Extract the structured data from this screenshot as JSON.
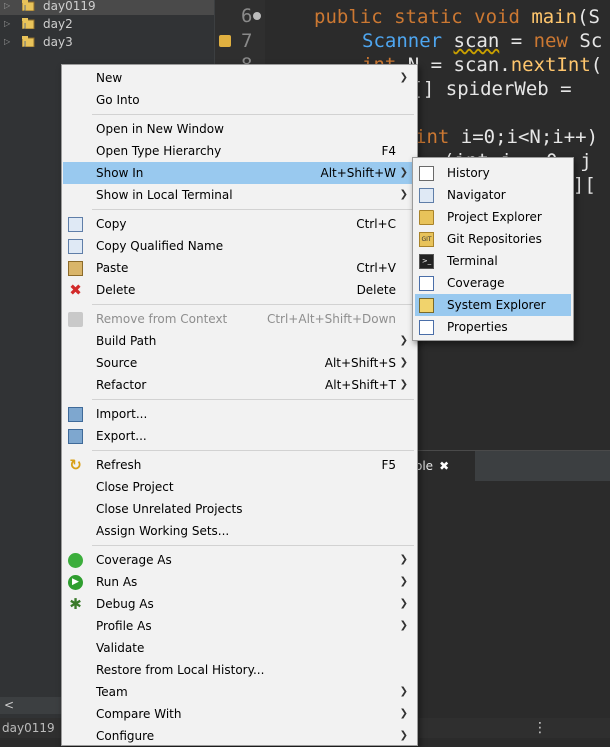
{
  "explorer": {
    "items": [
      {
        "label": "day0119",
        "selected": true
      },
      {
        "label": "day2",
        "selected": false
      },
      {
        "label": "day3",
        "selected": false
      }
    ],
    "scroll_left_glyph": "<",
    "status_project": "day0119"
  },
  "editor": {
    "line_numbers": [
      "6",
      "7",
      "8"
    ],
    "lines": [
      {
        "kw": "public static void ",
        "fn": "main",
        "rest": "(S"
      },
      {
        "cls": "Scanner ",
        "var": "scan",
        "rest": " = ",
        "kw": "new ",
        "tail": "Sc"
      },
      {
        "kw": "int ",
        "rest": "N = scan.",
        "fn": "nextInt",
        "tail": "("
      },
      {
        "rest": "][] spiderWeb = "
      },
      {
        "kw": "int ",
        "rest": "i=0;i<N;i++)"
      },
      {
        "rest": "(int j = 0; j"
      },
      {
        "rest": "[i]["
      }
    ],
    "console_tab_label": "ole",
    "console_close_glyph": "✖",
    "status_dots": "⋮"
  },
  "context_menu": {
    "items": [
      {
        "label": "New",
        "shortcut": "",
        "submenu": true,
        "icon": "none",
        "state": "normal"
      },
      {
        "label": "Go Into",
        "shortcut": "",
        "submenu": false,
        "icon": "none",
        "state": "normal"
      },
      {
        "sep": true
      },
      {
        "label": "Open in New Window",
        "shortcut": "",
        "submenu": false,
        "icon": "none",
        "state": "normal"
      },
      {
        "label": "Open Type Hierarchy",
        "shortcut": "F4",
        "submenu": false,
        "icon": "none",
        "state": "normal"
      },
      {
        "label": "Show In",
        "shortcut": "Alt+Shift+W",
        "submenu": true,
        "icon": "none",
        "state": "active"
      },
      {
        "label": "Show in Local Terminal",
        "shortcut": "",
        "submenu": true,
        "icon": "none",
        "state": "normal"
      },
      {
        "sep": true
      },
      {
        "label": "Copy",
        "shortcut": "Ctrl+C",
        "submenu": false,
        "icon": "copy-icon",
        "state": "normal"
      },
      {
        "label": "Copy Qualified Name",
        "shortcut": "",
        "submenu": false,
        "icon": "copy-qualified-icon",
        "state": "normal"
      },
      {
        "label": "Paste",
        "shortcut": "Ctrl+V",
        "submenu": false,
        "icon": "paste-icon",
        "state": "normal"
      },
      {
        "label": "Delete",
        "shortcut": "Delete",
        "submenu": false,
        "icon": "delete-icon",
        "state": "normal"
      },
      {
        "sep": true
      },
      {
        "label": "Remove from Context",
        "shortcut": "Ctrl+Alt+Shift+Down",
        "submenu": false,
        "icon": "remove-context-icon",
        "state": "disabled"
      },
      {
        "label": "Build Path",
        "shortcut": "",
        "submenu": true,
        "icon": "none",
        "state": "normal"
      },
      {
        "label": "Source",
        "shortcut": "Alt+Shift+S",
        "submenu": true,
        "icon": "none",
        "state": "normal"
      },
      {
        "label": "Refactor",
        "shortcut": "Alt+Shift+T",
        "submenu": true,
        "icon": "none",
        "state": "normal"
      },
      {
        "sep": true
      },
      {
        "label": "Import...",
        "shortcut": "",
        "submenu": false,
        "icon": "import-icon",
        "state": "normal"
      },
      {
        "label": "Export...",
        "shortcut": "",
        "submenu": false,
        "icon": "export-icon",
        "state": "normal"
      },
      {
        "sep": true
      },
      {
        "label": "Refresh",
        "shortcut": "F5",
        "submenu": false,
        "icon": "refresh-icon",
        "state": "normal"
      },
      {
        "label": "Close Project",
        "shortcut": "",
        "submenu": false,
        "icon": "none",
        "state": "normal"
      },
      {
        "label": "Close Unrelated Projects",
        "shortcut": "",
        "submenu": false,
        "icon": "none",
        "state": "normal"
      },
      {
        "label": "Assign Working Sets...",
        "shortcut": "",
        "submenu": false,
        "icon": "none",
        "state": "normal"
      },
      {
        "sep": true
      },
      {
        "label": "Coverage As",
        "shortcut": "",
        "submenu": true,
        "icon": "coverage-icon",
        "state": "normal"
      },
      {
        "label": "Run As",
        "shortcut": "",
        "submenu": true,
        "icon": "run-icon",
        "state": "normal"
      },
      {
        "label": "Debug As",
        "shortcut": "",
        "submenu": true,
        "icon": "debug-icon",
        "state": "normal"
      },
      {
        "label": "Profile As",
        "shortcut": "",
        "submenu": true,
        "icon": "none",
        "state": "normal"
      },
      {
        "label": "Validate",
        "shortcut": "",
        "submenu": false,
        "icon": "none",
        "state": "normal"
      },
      {
        "label": "Restore from Local History...",
        "shortcut": "",
        "submenu": false,
        "icon": "none",
        "state": "normal"
      },
      {
        "label": "Team",
        "shortcut": "",
        "submenu": true,
        "icon": "none",
        "state": "normal"
      },
      {
        "label": "Compare With",
        "shortcut": "",
        "submenu": true,
        "icon": "none",
        "state": "normal"
      },
      {
        "label": "Configure",
        "shortcut": "",
        "submenu": true,
        "icon": "none",
        "state": "normal"
      }
    ],
    "submenu_arrow": "❯"
  },
  "show_in_submenu": {
    "items": [
      {
        "label": "History",
        "icon": "history-icon",
        "state": "normal"
      },
      {
        "label": "Navigator",
        "icon": "navigator-icon",
        "state": "normal"
      },
      {
        "label": "Project Explorer",
        "icon": "project-explorer-icon",
        "state": "normal"
      },
      {
        "label": "Git Repositories",
        "icon": "git-repositories-icon",
        "state": "normal"
      },
      {
        "label": "Terminal",
        "icon": "terminal-icon",
        "state": "normal"
      },
      {
        "label": "Coverage",
        "icon": "coverage-view-icon",
        "state": "normal"
      },
      {
        "label": "System Explorer",
        "icon": "system-explorer-icon",
        "state": "active"
      },
      {
        "label": "Properties",
        "icon": "properties-icon",
        "state": "normal"
      }
    ]
  },
  "colors": {
    "menu_highlight": "#99c9ef",
    "menu_bg": "#f2f2f2",
    "editor_bg": "#2b2b2b"
  }
}
